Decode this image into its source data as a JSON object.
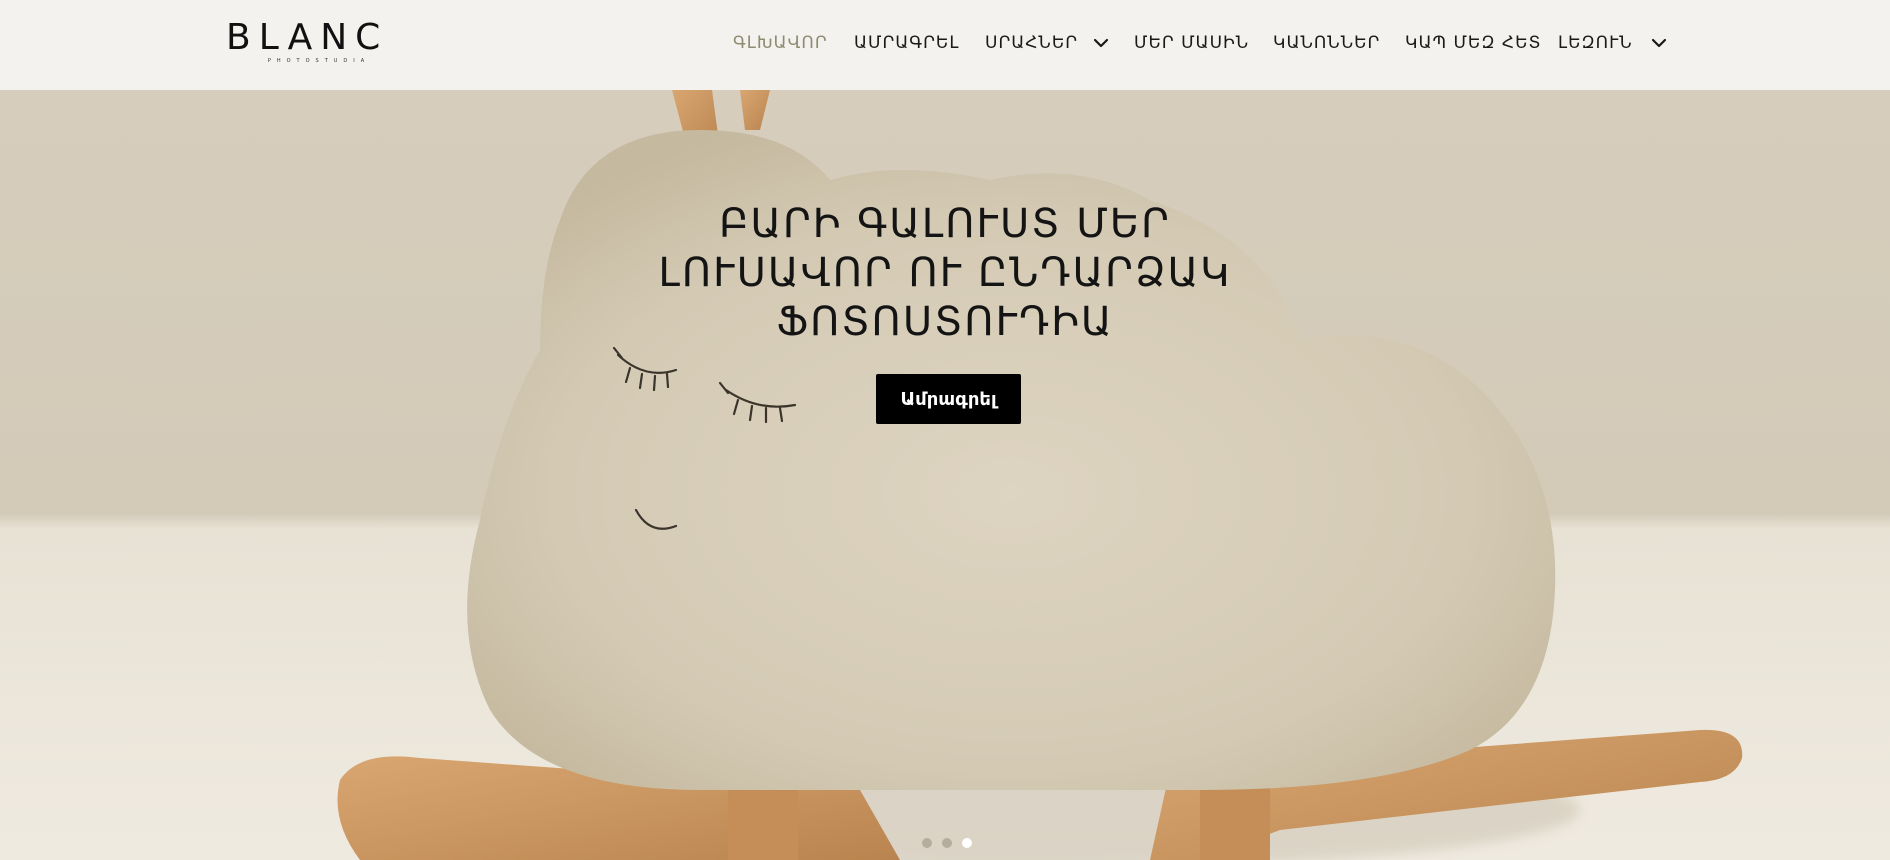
{
  "brand": {
    "name": "BLANC",
    "tagline": "PHOTOSTUDIA"
  },
  "nav": {
    "items": [
      {
        "label": "ԳԼԽԱՎՈՐ",
        "active": true
      },
      {
        "label": "ԱՄՐԱԳՐԵԼ"
      },
      {
        "label": "ՍՐԱՀՆԵՐ",
        "has_dropdown": true
      },
      {
        "label": "ՄԵՐ ՄԱՍԻՆ"
      },
      {
        "label": "ԿԱՆՈՆՆԵՐ"
      },
      {
        "label": "ԿԱՊ ՄԵԶ ՀԵՏ"
      },
      {
        "label": "ԼԵԶՈՒՆ",
        "has_dropdown": true
      }
    ]
  },
  "hero": {
    "title_lines": [
      "ԲԱՐԻ ԳԱԼՈՒՍՏ ՄԵՐ",
      "ԼՈՒՍԱՎՈՐ ՈՒ ԸՆԴԱՐՁԱԿ",
      "ՖՈՏՈՍՏՈՒԴԻԱ"
    ],
    "button_label": "Ամրագրել",
    "slides_total": 3,
    "active_slide": 3
  },
  "colors": {
    "header_bg": "#f3f2ee",
    "active_nav": "#8f8c73",
    "button_bg": "#000000",
    "button_text": "#ffffff"
  }
}
